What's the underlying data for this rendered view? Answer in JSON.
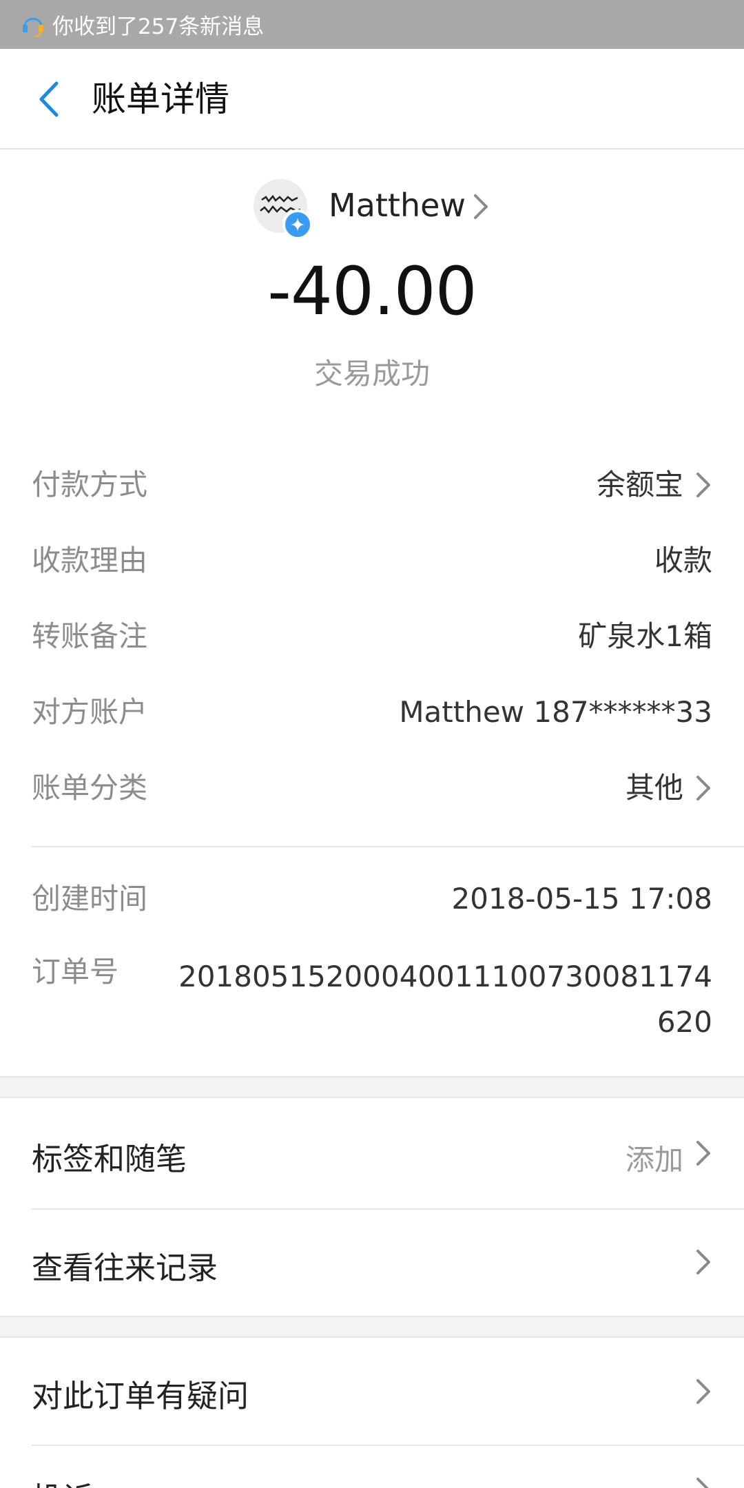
{
  "status_bar": {
    "notification_text": "你收到了257条新消息"
  },
  "nav": {
    "title": "账单详情"
  },
  "header": {
    "payee_name": "Matthew",
    "amount": "-40.00",
    "status": "交易成功"
  },
  "details": [
    {
      "label": "付款方式",
      "value": "余额宝",
      "has_chevron": true
    },
    {
      "label": "收款理由",
      "value": "收款",
      "has_chevron": false
    },
    {
      "label": "转账备注",
      "value": "矿泉水1箱",
      "has_chevron": false
    },
    {
      "label": "对方账户",
      "value": "Matthew 187******33",
      "has_chevron": false
    },
    {
      "label": "账单分类",
      "value": "其他",
      "has_chevron": true
    }
  ],
  "meta": {
    "created_label": "创建时间",
    "created_value": "2018-05-15 17:08",
    "order_label": "订单号",
    "order_value": "20180515200040011100730081174620"
  },
  "menu": {
    "tags_label": "标签和随笔",
    "tags_hint": "添加",
    "history_label": "查看往来记录",
    "question_label": "对此订单有疑问",
    "complaint_label": "投诉"
  },
  "colors": {
    "accent": "#1a8ae5",
    "badge": "#3a9cf0",
    "status_bar": "#a8a8a8",
    "section_gap": "#f4f4f6"
  }
}
